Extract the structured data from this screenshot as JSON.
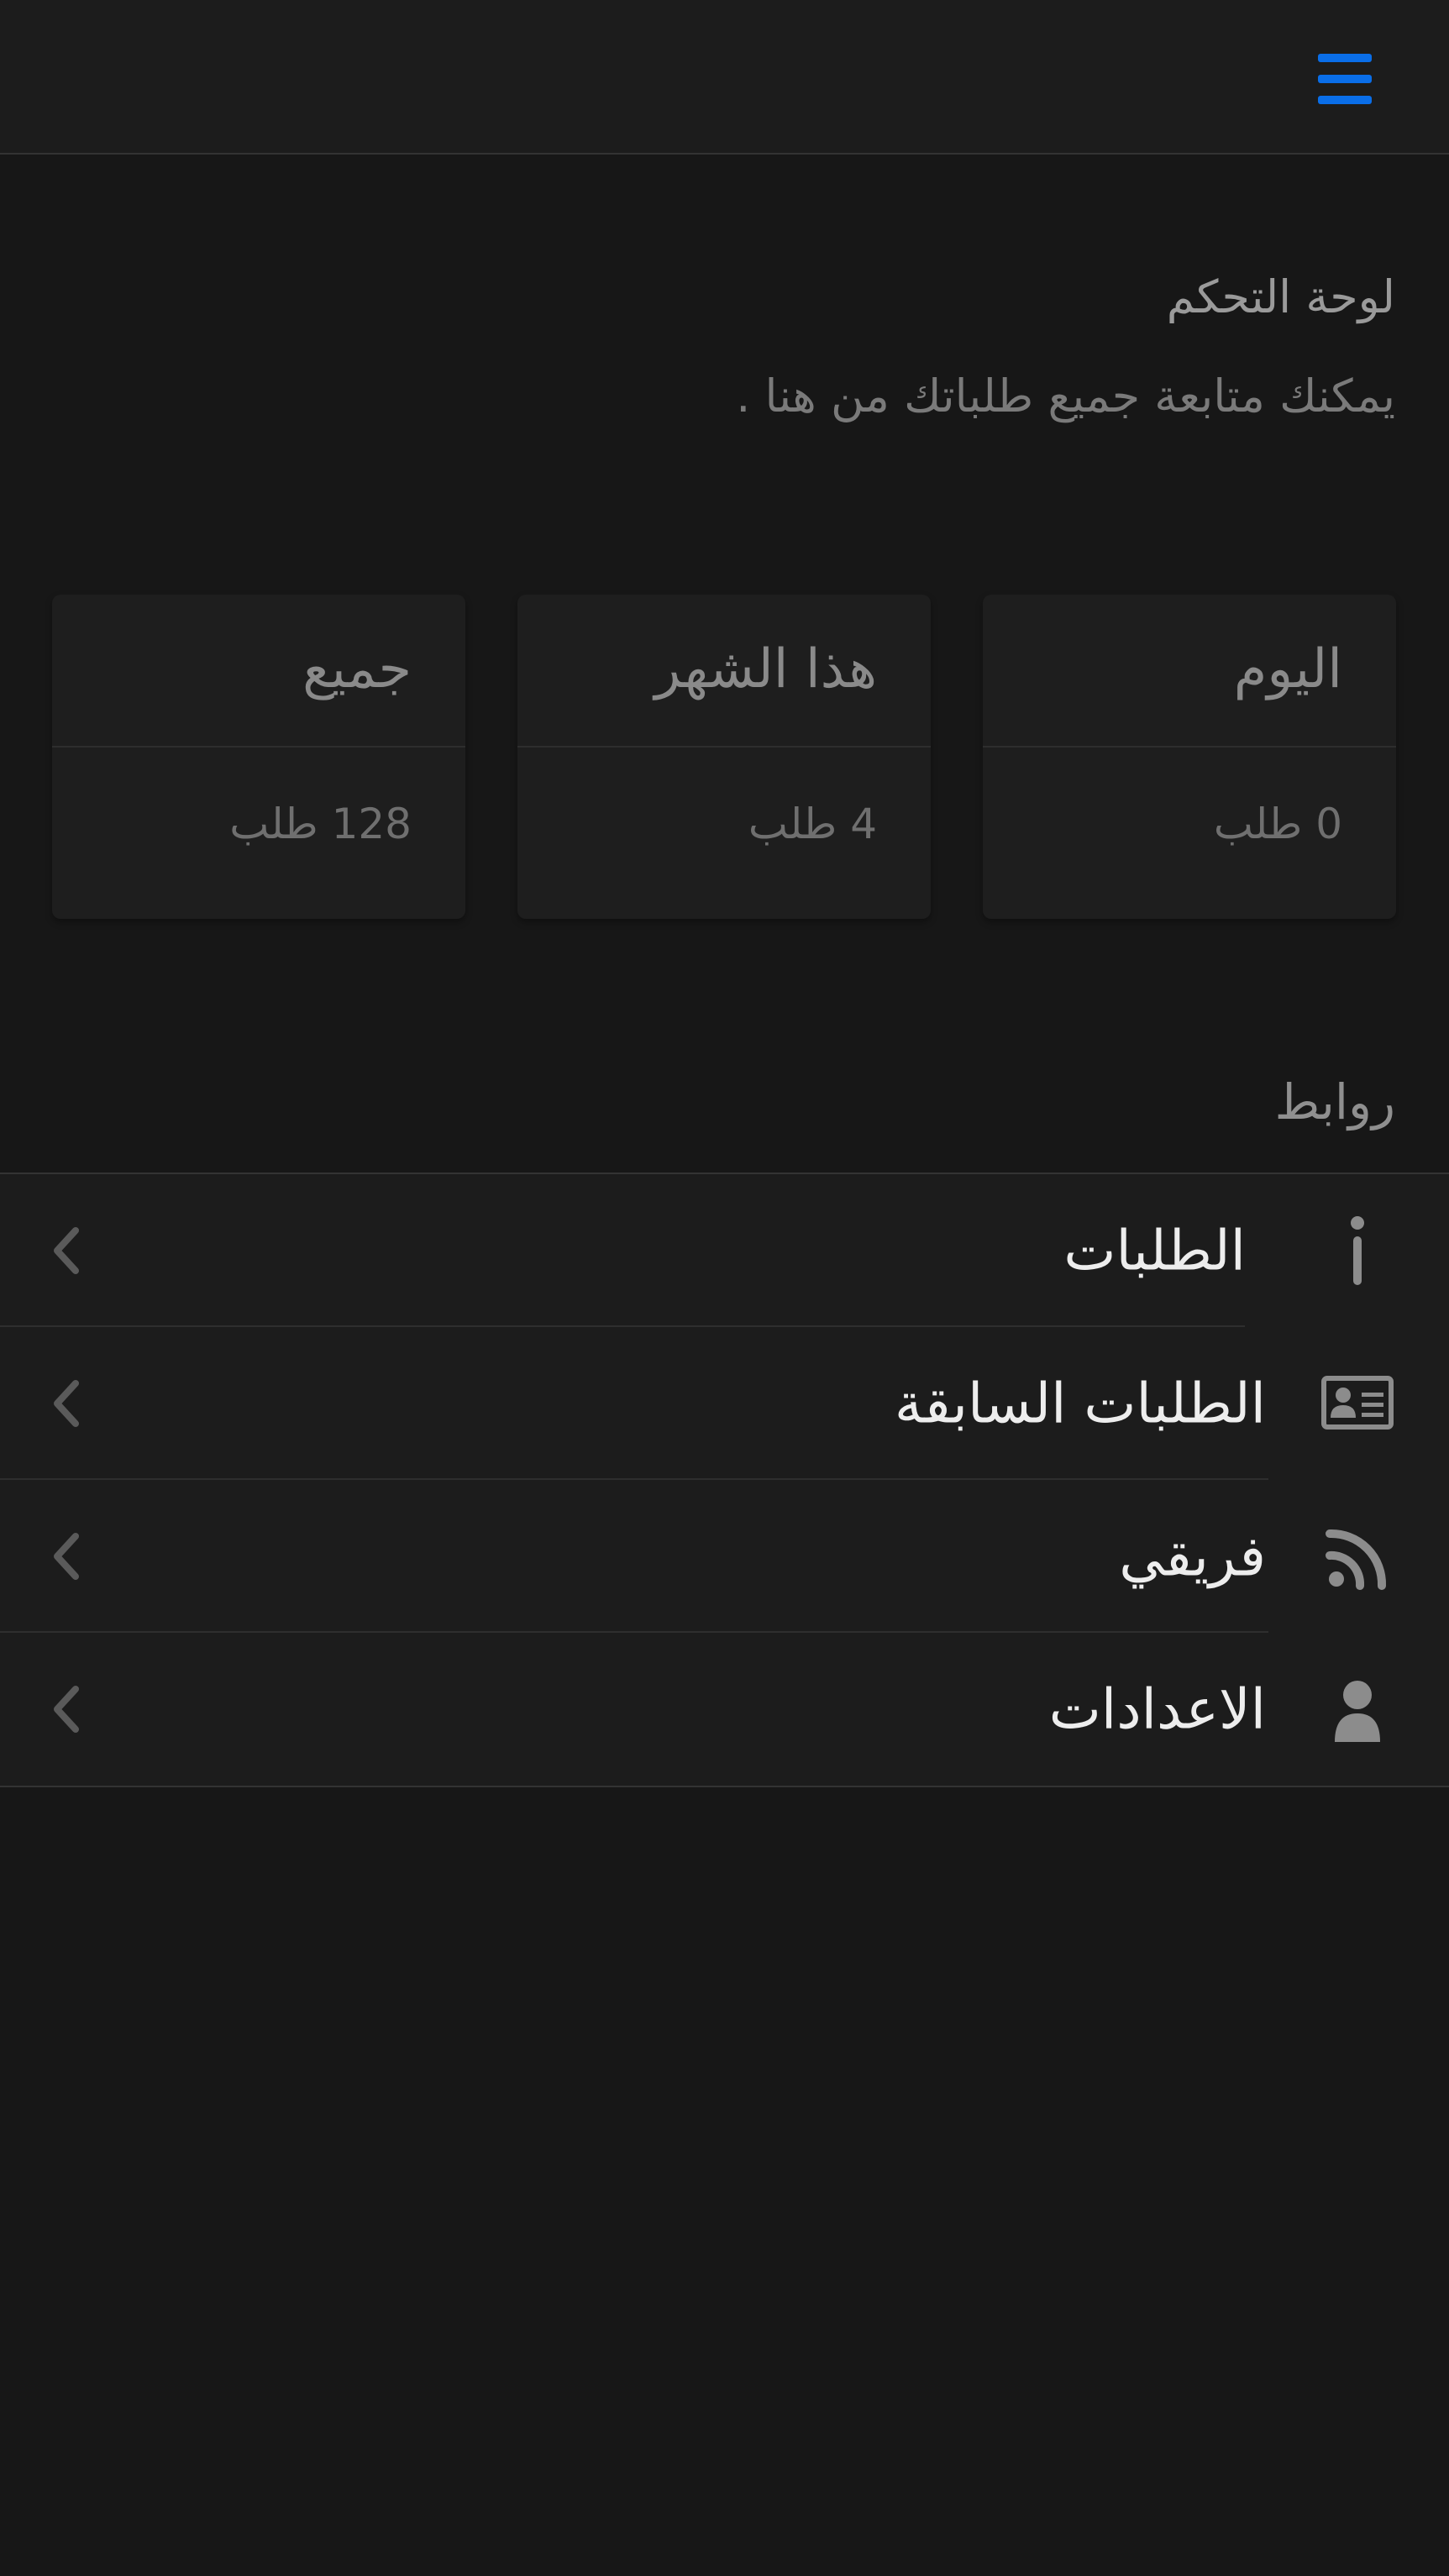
{
  "colors": {
    "accent": "#0a6ee8",
    "background": "#171717",
    "surface": "#1c1c1c",
    "icon": "#8c8c8c",
    "chevron": "#5a5a5a"
  },
  "header": {
    "menu_icon": "hamburger-menu-icon"
  },
  "dashboard": {
    "title": "لوحة التحكم",
    "subtitle": "يمكنك متابعة جميع طلباتك من هنا ."
  },
  "stats": {
    "today": {
      "title": "اليوم",
      "value": "0 طلب"
    },
    "month": {
      "title": "هذا الشهر",
      "value": "4 طلب"
    },
    "all": {
      "title": "جميع",
      "value": "128 طلب"
    }
  },
  "links": {
    "title": "روابط",
    "items": [
      {
        "label": "الطلبات",
        "icon": "info-icon"
      },
      {
        "label": "الطلبات السابقة",
        "icon": "contact-card-icon"
      },
      {
        "label": "فريقي",
        "icon": "rss-feed-icon"
      },
      {
        "label": "الاعدادات",
        "icon": "user-icon"
      }
    ]
  }
}
